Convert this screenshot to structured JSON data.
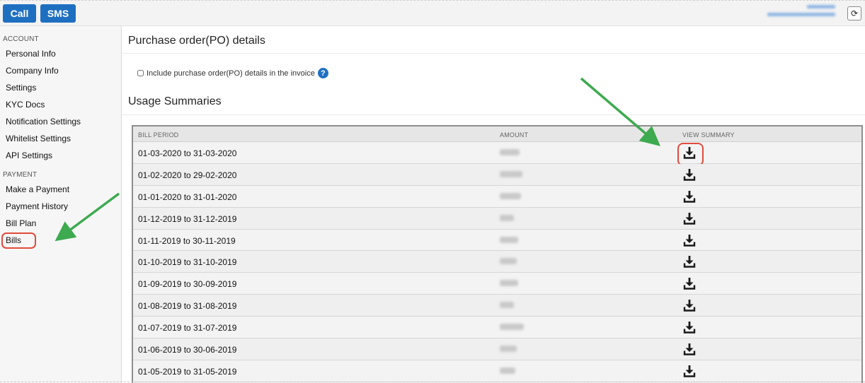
{
  "topbar": {
    "call_label": "Call",
    "sms_label": "SMS",
    "refresh_glyph": "⟳"
  },
  "sidebar": {
    "account_heading": "ACCOUNT",
    "account_items": [
      "Personal Info",
      "Company Info",
      "Settings",
      "KYC Docs",
      "Notification Settings",
      "Whitelist Settings",
      "API Settings"
    ],
    "payment_heading": "PAYMENT",
    "payment_items": [
      "Make a Payment",
      "Payment History",
      "Bill Plan",
      "Bills"
    ]
  },
  "main": {
    "po_title": "Purchase order(PO) details",
    "po_checkbox_label": "Include purchase order(PO) details in the invoice",
    "help_glyph": "?",
    "usage_title": "Usage Summaries",
    "table": {
      "headers": {
        "bill_period": "BILL PERIOD",
        "amount": "AMOUNT",
        "view_summary": "VIEW SUMMARY"
      },
      "rows": [
        "01-03-2020 to 31-03-2020",
        "01-02-2020 to 29-02-2020",
        "01-01-2020 to 31-01-2020",
        "01-12-2019 to 31-12-2019",
        "01-11-2019 to 30-11-2019",
        "01-10-2019 to 31-10-2019",
        "01-09-2019 to 30-09-2019",
        "01-08-2019 to 31-08-2019",
        "01-07-2019 to 31-07-2019",
        "01-06-2019 to 30-06-2019",
        "01-05-2019 to 31-05-2019"
      ]
    }
  },
  "colors": {
    "primary": "#1f6fc1",
    "highlight": "#e04b3d",
    "arrow": "#3daa4f"
  },
  "icons": {
    "download": "download-icon",
    "refresh": "refresh-icon",
    "help": "help-icon"
  }
}
